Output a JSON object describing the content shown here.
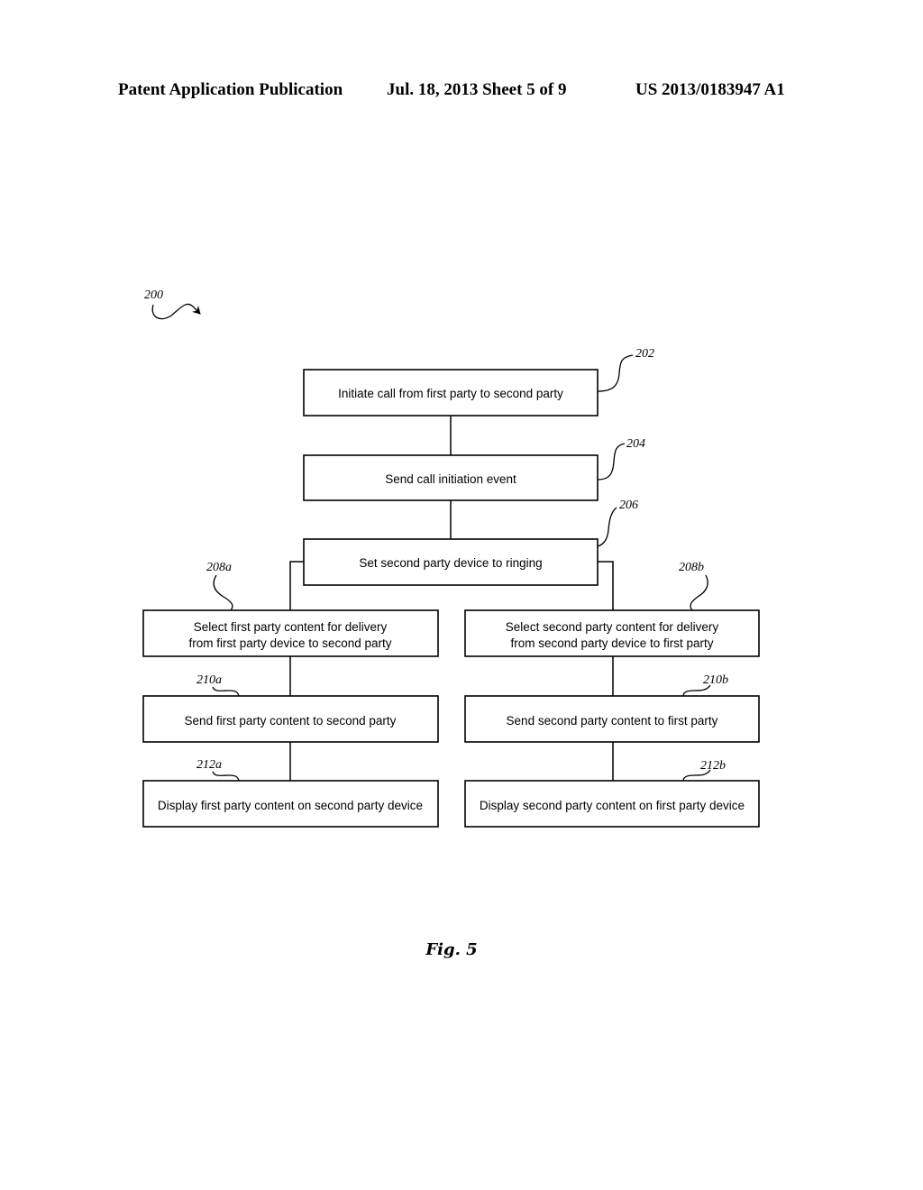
{
  "header": {
    "left": "Patent Application Publication",
    "middle": "Jul. 18, 2013   Sheet 5 of 9",
    "right": "US 2013/0183947 A1"
  },
  "figure": {
    "ref": "200",
    "caption": "Fig. 5"
  },
  "steps": {
    "s202": {
      "ref": "202",
      "lines": [
        "Initiate call from first party to second party"
      ]
    },
    "s204": {
      "ref": "204",
      "lines": [
        "Send call initiation event"
      ]
    },
    "s206": {
      "ref": "206",
      "lines": [
        "Set second party device to ringing"
      ]
    },
    "s208a": {
      "ref": "208a",
      "lines": [
        "Select first party content for delivery",
        "from first party device to second party"
      ]
    },
    "s208b": {
      "ref": "208b",
      "lines": [
        "Select second party content for delivery",
        "from second party device to first party"
      ]
    },
    "s210a": {
      "ref": "210a",
      "lines": [
        "Send first party content to second party"
      ]
    },
    "s210b": {
      "ref": "210b",
      "lines": [
        "Send second party content to first party"
      ]
    },
    "s212a": {
      "ref": "212a",
      "lines": [
        "Display first party content on second party device"
      ]
    },
    "s212b": {
      "ref": "212b",
      "lines": [
        "Display second party content on first party device"
      ]
    }
  }
}
